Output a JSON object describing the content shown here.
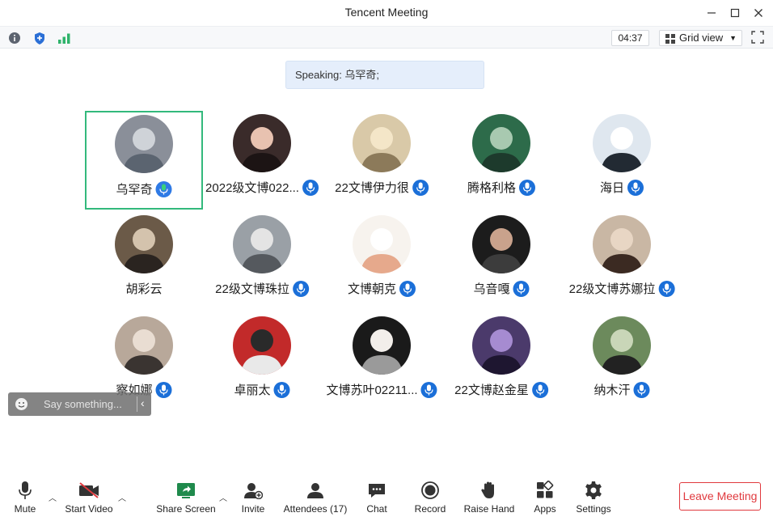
{
  "window": {
    "title": "Tencent Meeting"
  },
  "infobar": {
    "timer": "04:37",
    "view_mode": "Grid view"
  },
  "speaking": {
    "text": "Speaking: 乌罕奇;"
  },
  "participants": [
    {
      "name": "乌罕奇",
      "active": true,
      "mic": "speaking"
    },
    {
      "name": "2022级文博022...",
      "mic": "on"
    },
    {
      "name": "22文博伊力很",
      "mic": "on"
    },
    {
      "name": "腾格利格",
      "mic": "on"
    },
    {
      "name": "海日",
      "mic": "on"
    },
    {
      "name": "胡彩云",
      "mic": "none"
    },
    {
      "name": "22级文博珠拉",
      "mic": "on"
    },
    {
      "name": "文博朝克",
      "mic": "on"
    },
    {
      "name": "乌音嘎",
      "mic": "on"
    },
    {
      "name": "22级文博苏娜拉",
      "mic": "on"
    },
    {
      "name": "察如娜",
      "mic": "on"
    },
    {
      "name": "卓丽太",
      "mic": "on"
    },
    {
      "name": "文博苏叶02211...",
      "mic": "on"
    },
    {
      "name": "22文博赵金星",
      "mic": "on"
    },
    {
      "name": "纳木汗",
      "mic": "on"
    }
  ],
  "chat": {
    "placeholder": "Say something..."
  },
  "toolbar": {
    "mute": "Mute",
    "start_video": "Start Video",
    "share_screen": "Share Screen",
    "invite": "Invite",
    "attendees": "Attendees (17)",
    "chat": "Chat",
    "record": "Record",
    "raise_hand": "Raise Hand",
    "apps": "Apps",
    "settings": "Settings",
    "leave": "Leave Meeting"
  },
  "colors": {
    "accent": "#1b6fd8",
    "active_border": "#33b97c",
    "leave": "#e0393e",
    "speaking_bg": "#e5eefb"
  }
}
